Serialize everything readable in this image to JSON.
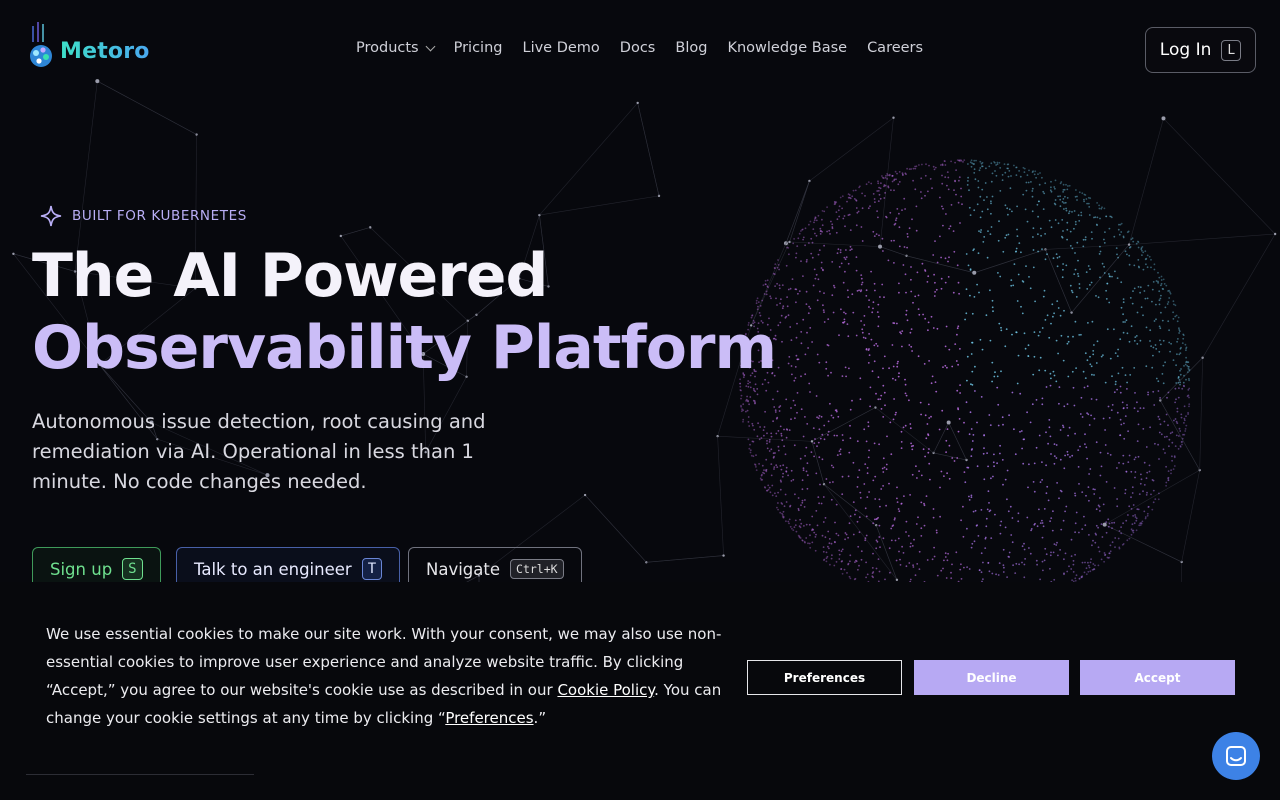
{
  "brand": {
    "name": "Metoro"
  },
  "nav": {
    "items": [
      {
        "label": "Products",
        "has_dropdown": true
      },
      {
        "label": "Pricing"
      },
      {
        "label": "Live Demo"
      },
      {
        "label": "Docs"
      },
      {
        "label": "Blog"
      },
      {
        "label": "Knowledge Base"
      },
      {
        "label": "Careers"
      }
    ],
    "login_label": "Log In",
    "login_key": "L"
  },
  "hero": {
    "badge": "BUILT FOR KUBERNETES",
    "title_line1": "The AI Powered",
    "title_line2": "Observability Platform",
    "subtitle": "Autonomous issue detection, root causing and remediation via AI. Operational in less than 1 minute. No code changes needed.",
    "cta": {
      "signup_label": "Sign up",
      "signup_key": "S",
      "talk_label": "Talk to an engineer",
      "talk_key": "T",
      "navigate_label": "Navigate",
      "navigate_key": "Ctrl+K"
    }
  },
  "cookie": {
    "text_before_policy": "We use essential cookies to make our site work. With your consent, we may also use non-essential cookies to improve user experience and analyze website traffic. By clicking “Accept,” you agree to our website's cookie use as described in our ",
    "policy_link": "Cookie Policy",
    "text_middle": ". You can change your cookie settings at any time by clicking “",
    "preferences_link": "Preferences",
    "text_end": ".”",
    "preferences_button": "Preferences",
    "decline_button": "Decline",
    "accept_button": "Accept"
  },
  "colors": {
    "background": "#07080d",
    "accent_lavender": "#b7a9f3",
    "title_lavender": "#cbbdf7",
    "signup_green": "#6fe08f",
    "talk_blue": "#4860a8",
    "chat_blue": "#3d82e6"
  },
  "icons": [
    "metoro-logo-icon",
    "sparkle-icon",
    "chevron-down-icon",
    "chat-icon"
  ]
}
